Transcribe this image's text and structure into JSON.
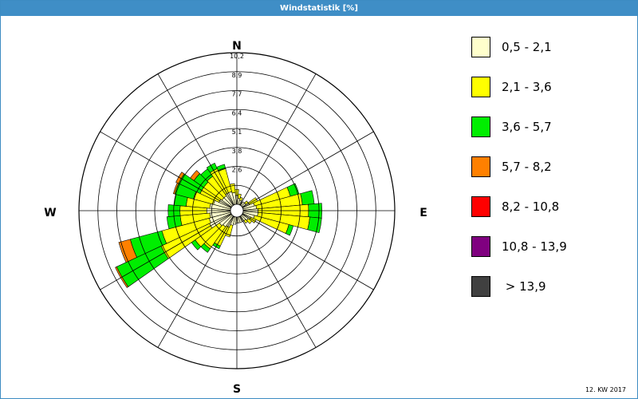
{
  "window": {
    "title": "Windstatistik [%]",
    "footer": "12. KW 2017"
  },
  "colors": {
    "frame": "#3f8ec6",
    "grid": "#000000"
  },
  "chart_data": {
    "type": "wind-rose",
    "title": "Windstatistik [%]",
    "directions": [
      "N",
      "E",
      "S",
      "W"
    ],
    "radial_ticks": [
      "2,6",
      "3,8",
      "5,1",
      "6,4",
      "7,7",
      "8,9",
      "10,2"
    ],
    "rlim": [
      0,
      10.2
    ],
    "sectors": 36,
    "grid": true,
    "legend_placement": "right",
    "speed_classes": [
      {
        "name": "0,5 - 2,1",
        "color": "#ffffcc"
      },
      {
        "name": "2,1 - 3,6",
        "color": "#ffff00"
      },
      {
        "name": "3,6 - 5,7",
        "color": "#00ee00"
      },
      {
        "name": "5,7 - 8,2",
        "color": "#ff8000"
      },
      {
        "name": "8,2 - 10,8",
        "color": "#ff0000"
      },
      {
        "name": "10,8 - 13,9",
        "color": "#800080"
      },
      {
        "name": " > 13,9",
        "color": "#404040"
      }
    ],
    "data": [
      {
        "dir": 0,
        "values": [
          0.6,
          0.4
        ]
      },
      {
        "dir": 10,
        "values": [
          0.4,
          0.3
        ]
      },
      {
        "dir": 20,
        "values": [
          0.3,
          0.2
        ]
      },
      {
        "dir": 30,
        "values": [
          0.2
        ]
      },
      {
        "dir": 40,
        "values": [
          0.3
        ]
      },
      {
        "dir": 50,
        "values": [
          0.3,
          0.2
        ]
      },
      {
        "dir": 60,
        "values": [
          0.5,
          0.6
        ]
      },
      {
        "dir": 70,
        "values": [
          0.8,
          2.5,
          0.6
        ]
      },
      {
        "dir": 80,
        "values": [
          0.9,
          3.1,
          0.8
        ]
      },
      {
        "dir": 90,
        "values": [
          1.0,
          3.4,
          0.9
        ]
      },
      {
        "dir": 100,
        "values": [
          1.0,
          3.5,
          0.8
        ]
      },
      {
        "dir": 110,
        "values": [
          0.8,
          2.4,
          0.3
        ]
      },
      {
        "dir": 120,
        "values": [
          0.6,
          0.4
        ]
      },
      {
        "dir": 130,
        "values": [
          0.5,
          0.3
        ]
      },
      {
        "dir": 140,
        "values": [
          0.4,
          0.2
        ]
      },
      {
        "dir": 150,
        "values": [
          0.4
        ]
      },
      {
        "dir": 160,
        "values": [
          0.4
        ]
      },
      {
        "dir": 170,
        "values": [
          0.4
        ]
      },
      {
        "dir": 180,
        "values": [
          0.4
        ]
      },
      {
        "dir": 190,
        "values": [
          0.5
        ]
      },
      {
        "dir": 200,
        "values": [
          0.6,
          0.8
        ]
      },
      {
        "dir": 210,
        "values": [
          0.8,
          1.4,
          0.2
        ]
      },
      {
        "dir": 220,
        "values": [
          0.9,
          1.8,
          0.3
        ]
      },
      {
        "dir": 230,
        "values": [
          1.0,
          2.0,
          0.3
        ]
      },
      {
        "dir": 240,
        "values": [
          1.6,
          3.6,
          3.3,
          0.1
        ]
      },
      {
        "dir": 250,
        "values": [
          1.5,
          3.3,
          2.2,
          0.8
        ]
      },
      {
        "dir": 260,
        "values": [
          1.4,
          2.0,
          0.9
        ]
      },
      {
        "dir": 270,
        "values": [
          1.6,
          1.8,
          0.8
        ]
      },
      {
        "dir": 280,
        "values": [
          1.4,
          1.6,
          0.8
        ]
      },
      {
        "dir": 290,
        "values": [
          1.2,
          1.4,
          1.3,
          0.1
        ]
      },
      {
        "dir": 300,
        "values": [
          0.9,
          1.4,
          1.6,
          0.2
        ]
      },
      {
        "dir": 310,
        "values": [
          0.8,
          1.5,
          0.8,
          0.3
        ]
      },
      {
        "dir": 320,
        "values": [
          0.8,
          1.6,
          0.6
        ]
      },
      {
        "dir": 330,
        "values": [
          0.9,
          1.8,
          0.4
        ]
      },
      {
        "dir": 340,
        "values": [
          0.9,
          1.6,
          0.3
        ]
      },
      {
        "dir": 350,
        "values": [
          0.8,
          0.6
        ]
      }
    ]
  }
}
